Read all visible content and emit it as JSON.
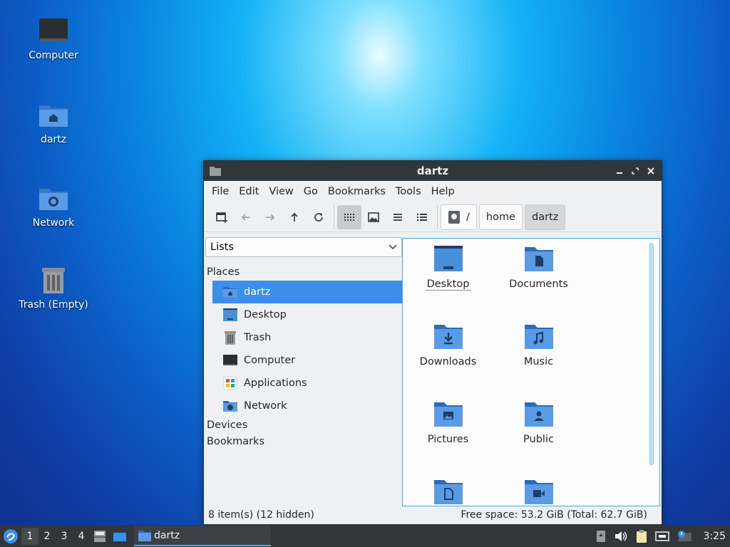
{
  "desktop": {
    "icons": [
      {
        "label": "Computer"
      },
      {
        "label": "dartz"
      },
      {
        "label": "Network"
      },
      {
        "label": "Trash (Empty)"
      }
    ]
  },
  "window": {
    "title": "dartz",
    "menu": [
      "File",
      "Edit",
      "View",
      "Go",
      "Bookmarks",
      "Tools",
      "Help"
    ],
    "path": {
      "root": "/",
      "crumbs": [
        "home",
        "dartz"
      ]
    },
    "sidepane": {
      "mode": "Lists",
      "places_header": "Places",
      "places": [
        "dartz",
        "Desktop",
        "Trash",
        "Computer",
        "Applications",
        "Network"
      ],
      "devices_header": "Devices",
      "bookmarks_header": "Bookmarks"
    },
    "files": [
      "Desktop",
      "Documents",
      "Downloads",
      "Music",
      "Pictures",
      "Public",
      "",
      ""
    ],
    "status": {
      "items": "8 item(s) (12 hidden)",
      "free": "Free space: 53.2 GiB (Total: 62.7 GiB)"
    }
  },
  "taskbar": {
    "workspaces": [
      "1",
      "2",
      "3",
      "4"
    ],
    "active_workspace": "1",
    "task_label": "dartz",
    "clock": "3:25"
  },
  "colors": {
    "accent": "#3d8ee8",
    "folder": "#4a90d9",
    "titlebar": "#31363b"
  }
}
